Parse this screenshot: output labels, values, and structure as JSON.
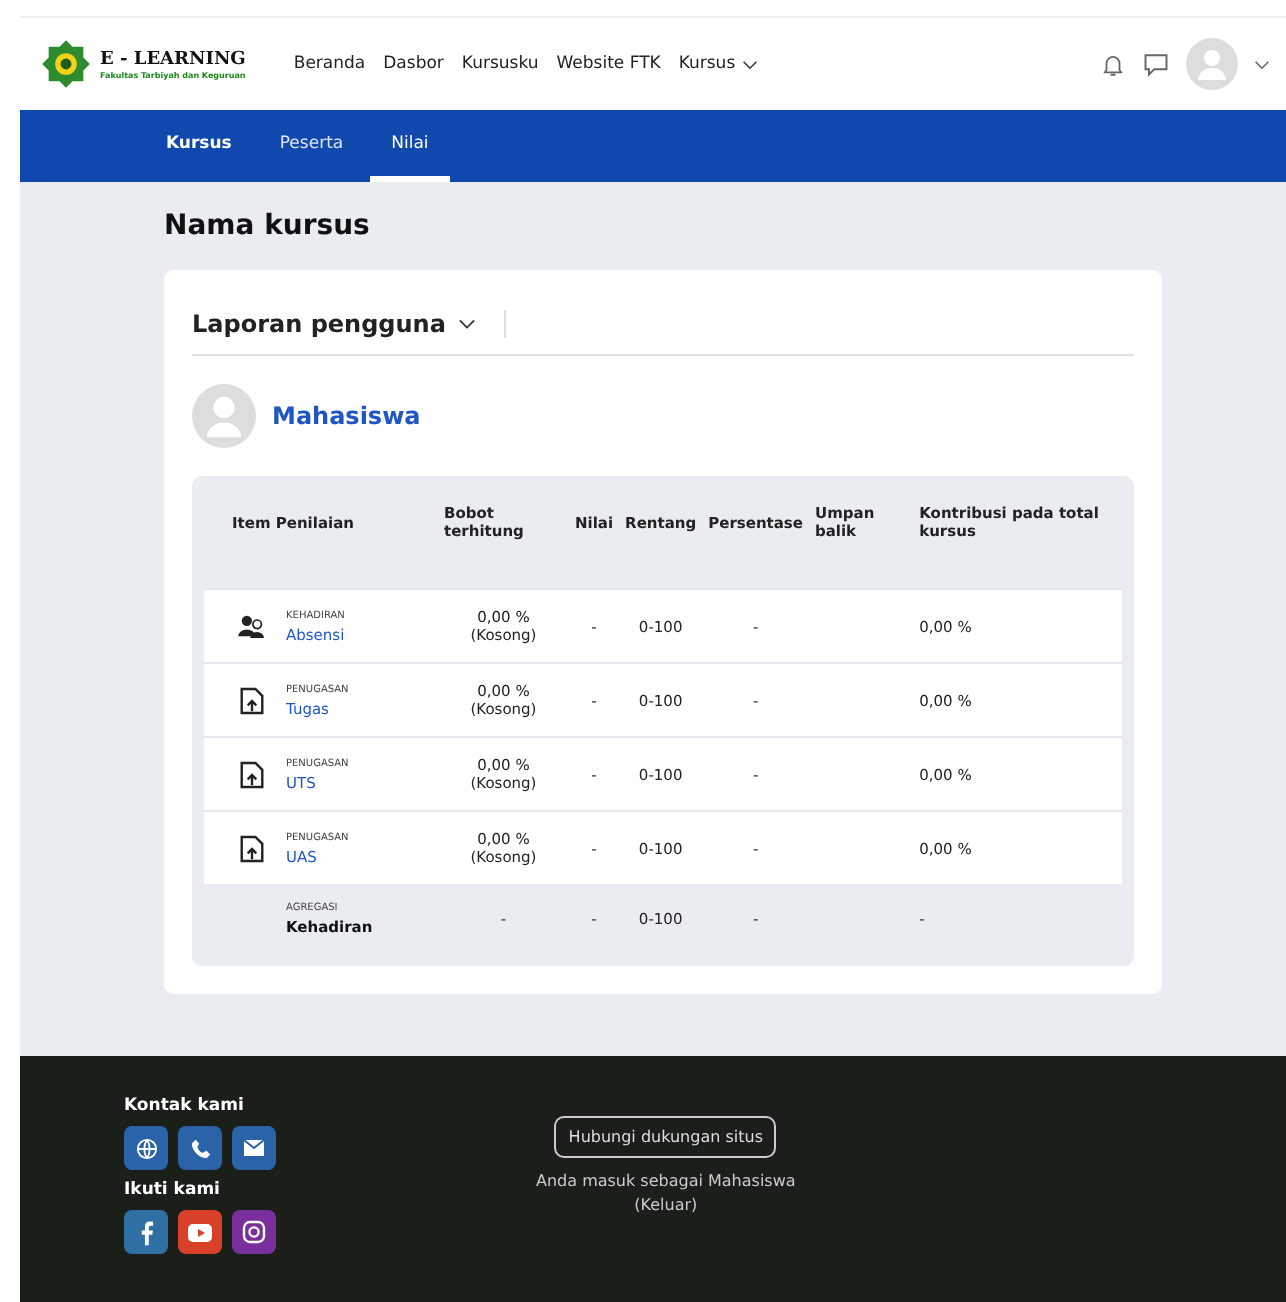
{
  "brand": {
    "title": "E - LEARNING",
    "subtitle": "Fakultas Tarbiyah dan Keguruan"
  },
  "nav": [
    {
      "label": "Beranda",
      "dropdown": false
    },
    {
      "label": "Dasbor",
      "dropdown": false
    },
    {
      "label": "Kursusku",
      "dropdown": false
    },
    {
      "label": "Website FTK",
      "dropdown": false
    },
    {
      "label": "Kursus",
      "dropdown": true
    }
  ],
  "tabs": [
    {
      "label": "Kursus",
      "selected": false,
      "bold": true
    },
    {
      "label": "Peserta",
      "selected": false,
      "bold": false
    },
    {
      "label": "Nilai",
      "selected": true,
      "bold": false
    }
  ],
  "page_title": "Nama kursus",
  "report_selector": "Laporan pengguna",
  "user": {
    "name": "Mahasiswa"
  },
  "table": {
    "columns": [
      "Item Penilaian",
      "Bobot terhitung",
      "Nilai",
      "Rentang",
      "Persentase",
      "Umpan balik",
      "Kontribusi pada total kursus"
    ],
    "rows": [
      {
        "kind": "attendance",
        "category": "KEHADIRAN",
        "name": "Absensi",
        "weight": "0,00 %",
        "weight_note": "(Kosong)",
        "grade": "-",
        "range": "0-100",
        "percentage": "-",
        "contribution": "0,00 %"
      },
      {
        "kind": "assignment",
        "category": "PENUGASAN",
        "name": "Tugas",
        "weight": "0,00 %",
        "weight_note": "(Kosong)",
        "grade": "-",
        "range": "0-100",
        "percentage": "-",
        "contribution": "0,00 %"
      },
      {
        "kind": "assignment",
        "category": "PENUGASAN",
        "name": "UTS",
        "weight": "0,00 %",
        "weight_note": "(Kosong)",
        "grade": "-",
        "range": "0-100",
        "percentage": "-",
        "contribution": "0,00 %"
      },
      {
        "kind": "assignment",
        "category": "PENUGASAN",
        "name": "UAS",
        "weight": "0,00 %",
        "weight_note": "(Kosong)",
        "grade": "-",
        "range": "0-100",
        "percentage": "-",
        "contribution": "0,00 %"
      },
      {
        "kind": "aggregate",
        "category": "AGREGASI",
        "name": "Kehadiran",
        "weight": "-",
        "grade": "-",
        "range": "0-100",
        "percentage": "-",
        "contribution": "-"
      }
    ]
  },
  "footer": {
    "contact_title": "Kontak kami",
    "follow_title": "Ikuti kami",
    "support_button": "Hubungi dukungan situs",
    "login_text": "Anda masuk sebagai Mahasiswa",
    "logout_link": "(Keluar)"
  }
}
